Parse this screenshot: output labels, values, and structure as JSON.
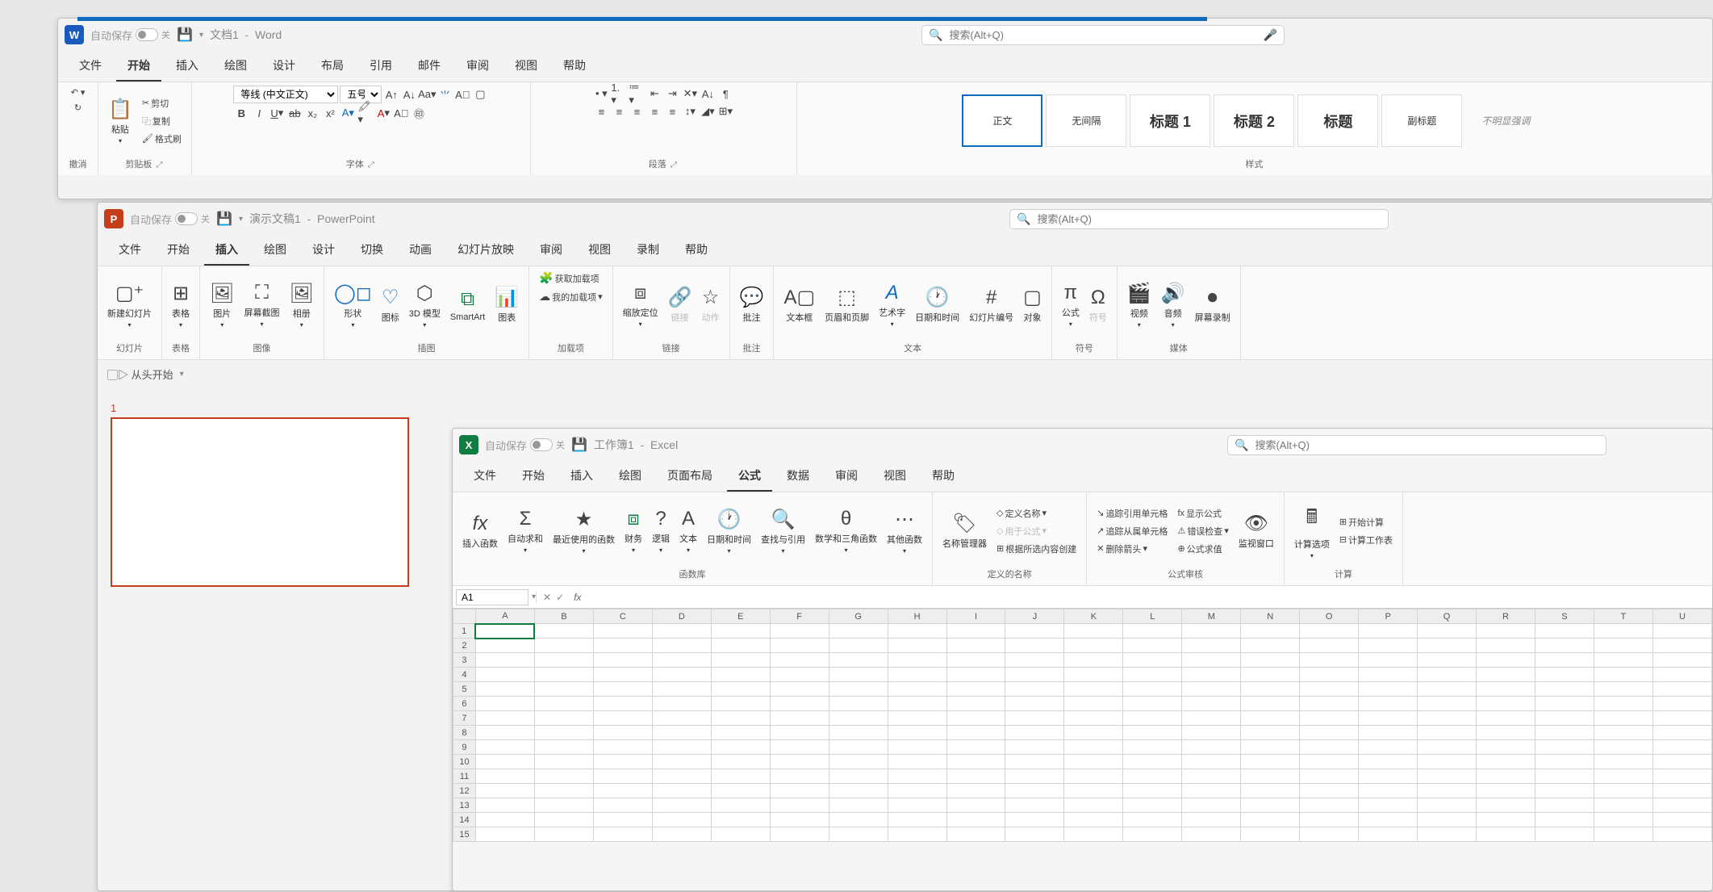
{
  "word": {
    "autosave": "自动保存",
    "autosave_state": "关",
    "doc_title": "文档1",
    "app_name": "Word",
    "search_placeholder": "搜索(Alt+Q)",
    "menus": [
      "文件",
      "开始",
      "插入",
      "绘图",
      "设计",
      "布局",
      "引用",
      "邮件",
      "审阅",
      "视图",
      "帮助"
    ],
    "active_menu": 1,
    "ribbon": {
      "undo_group": "撤消",
      "clipboard": {
        "paste": "粘贴",
        "cut": "剪切",
        "copy": "复制",
        "format_painter": "格式刷",
        "label": "剪贴板"
      },
      "font": {
        "name": "等线 (中文正文)",
        "size": "五号",
        "label": "字体"
      },
      "paragraph": {
        "label": "段落"
      },
      "styles": {
        "label": "样式",
        "items": [
          "正文",
          "无间隔",
          "标题 1",
          "标题 2",
          "标题",
          "副标题",
          "不明显强调"
        ],
        "active": 0
      }
    }
  },
  "ppt": {
    "autosave": "自动保存",
    "autosave_state": "关",
    "doc_title": "演示文稿1",
    "app_name": "PowerPoint",
    "search_placeholder": "搜索(Alt+Q)",
    "menus": [
      "文件",
      "开始",
      "插入",
      "绘图",
      "设计",
      "切换",
      "动画",
      "幻灯片放映",
      "审阅",
      "视图",
      "录制",
      "帮助"
    ],
    "active_menu": 2,
    "ribbon": {
      "slides": {
        "new_slide": "新建幻灯片",
        "label": "幻灯片"
      },
      "tables": {
        "table": "表格",
        "label": "表格"
      },
      "images": {
        "pictures": "图片",
        "screenshot": "屏幕截图",
        "album": "相册",
        "label": "图像"
      },
      "illustrations": {
        "shapes": "形状",
        "icons": "图标",
        "models": "3D 模型",
        "smartart": "SmartArt",
        "chart": "图表",
        "label": "插图"
      },
      "addins": {
        "get": "获取加载项",
        "my": "我的加载项",
        "label": "加载项"
      },
      "links": {
        "zoom": "缩放定位",
        "link": "链接",
        "action": "动作",
        "label": "链接"
      },
      "comments": {
        "comment": "批注",
        "label": "批注"
      },
      "text": {
        "textbox": "文本框",
        "header_footer": "页眉和页脚",
        "wordart": "艺术字",
        "datetime": "日期和时间",
        "slide_number": "幻灯片编号",
        "object": "对象",
        "label": "文本"
      },
      "symbols": {
        "equation": "公式",
        "symbol": "符号",
        "label": "符号"
      },
      "media": {
        "video": "视频",
        "audio": "音频",
        "screen_rec": "屏幕录制",
        "label": "媒体"
      }
    },
    "quickbar": {
      "from_beginning": "从头开始"
    },
    "slide_number": "1"
  },
  "excel": {
    "autosave": "自动保存",
    "autosave_state": "关",
    "doc_title": "工作簿1",
    "app_name": "Excel",
    "search_placeholder": "搜索(Alt+Q)",
    "menus": [
      "文件",
      "开始",
      "插入",
      "绘图",
      "页面布局",
      "公式",
      "数据",
      "审阅",
      "视图",
      "帮助"
    ],
    "active_menu": 5,
    "ribbon": {
      "library": {
        "insert_fn": "插入函数",
        "autosum": "自动求和",
        "recent": "最近使用的函数",
        "financial": "财务",
        "logical": "逻辑",
        "text": "文本",
        "datetime": "日期和时间",
        "lookup": "查找与引用",
        "math": "数学和三角函数",
        "more": "其他函数",
        "label": "函数库"
      },
      "names": {
        "manager": "名称管理器",
        "define": "定义名称",
        "use": "用于公式",
        "create": "根据所选内容创建",
        "label": "定义的名称"
      },
      "audit": {
        "precedents": "追踪引用单元格",
        "dependents": "追踪从属单元格",
        "remove_arrows": "删除箭头",
        "show_formulas": "显示公式",
        "error_check": "错误检查",
        "evaluate": "公式求值",
        "watch": "监视窗口",
        "label": "公式审核"
      },
      "calc": {
        "options": "计算选项",
        "now": "开始计算",
        "sheet": "计算工作表",
        "label": "计算"
      }
    },
    "name_box": "A1",
    "columns": [
      "A",
      "B",
      "C",
      "D",
      "E",
      "F",
      "G",
      "H",
      "I",
      "J",
      "K",
      "L",
      "M",
      "N",
      "O",
      "P",
      "Q",
      "R",
      "S",
      "T",
      "U"
    ],
    "rows": [
      "1",
      "2",
      "3",
      "4",
      "5",
      "6",
      "7",
      "8",
      "9",
      "10",
      "11",
      "12",
      "13",
      "14",
      "15"
    ],
    "active_cell": {
      "row": 0,
      "col": 0
    }
  }
}
